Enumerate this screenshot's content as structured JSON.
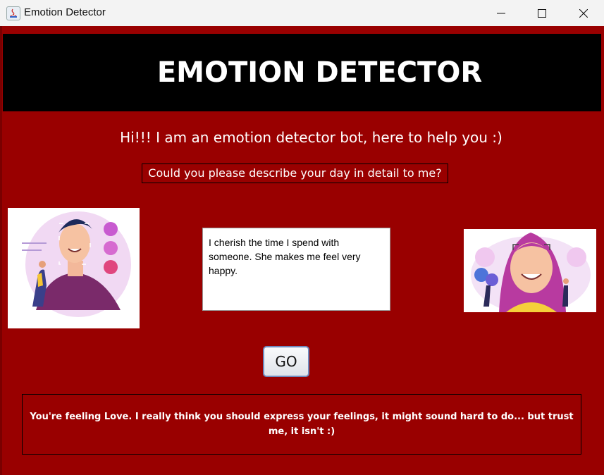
{
  "window": {
    "title": "Emotion Detector",
    "icons": {
      "app": "java-icon",
      "minimize": "minimize-icon",
      "maximize": "maximize-icon",
      "close": "close-icon"
    }
  },
  "header": {
    "title": "EMOTION DETECTOR"
  },
  "greeting": "Hi!!! I am an emotion detector bot, here to help you :)",
  "prompt": "Could you please describe your day in detail to me?",
  "input": {
    "value": "I cherish the time I spend with someone. She makes me feel very happy."
  },
  "go_button": {
    "label": "GO"
  },
  "response": "You're feeling Love. I really think you should express your feelings, it might sound hard to do... but trust me, it isn't :)",
  "colors": {
    "background": "#990000",
    "header": "#000000",
    "text": "#ffffff"
  }
}
